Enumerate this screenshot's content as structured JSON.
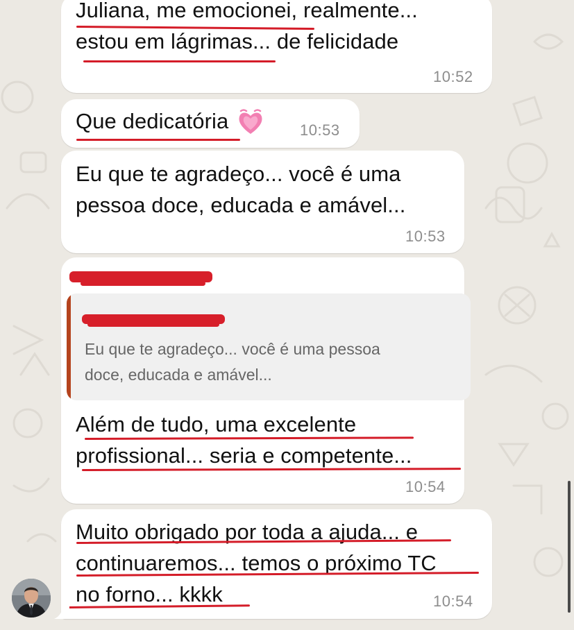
{
  "chat": {
    "messages": [
      {
        "text": "Juliana, me emocionei, realmente...\nestou em lágrimas... de felicidade",
        "time": "10:52"
      },
      {
        "text": "Que dedicatória",
        "emoji": "growing-heart-icon",
        "time": "10:53"
      },
      {
        "text": "Eu que te agradeço... você é uma\npessoa doce, educada e amável...",
        "time": "10:53"
      },
      {
        "quote": "Eu que te agradeço... você é uma pessoa\ndoce, educada e amável...",
        "text": "Além de tudo, uma excelente\nprofissional... seria e competente...",
        "time": "10:54"
      },
      {
        "text": "Muito obrigado por toda a ajuda... e\ncontinuaremos... temos o próximo TC\nno forno... kkkk",
        "time": "10:54"
      }
    ]
  },
  "colors": {
    "background": "#ece9e3",
    "bubble": "#ffffff",
    "annotation_red": "#d41c28",
    "quote_bar": "#b5431d"
  }
}
